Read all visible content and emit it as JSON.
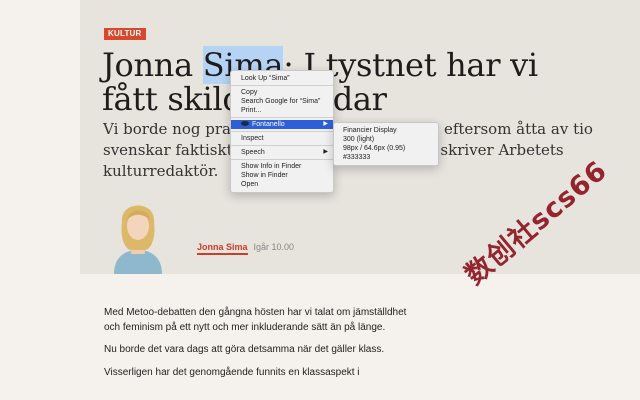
{
  "article": {
    "kicker": "KULTUR",
    "title_before": "Jonna ",
    "title_selected": "Sima",
    "title_after": ": I tystnet har vi fått skilda världar",
    "lede": "Vi borde nog prata mer om klass. Inte minst eftersom åtta av tio svenskar faktiskt anser att klass spelar roll, skriver Arbetets kulturredaktör.",
    "author": "Jonna Sima",
    "time": "Igår 10.00",
    "paragraphs": [
      "Med Metoo-debatten den gångna hösten har vi talat om jämställdhet och feminism på ett nytt och mer inkluderande sätt än på länge.",
      "Nu borde det vara dags att göra detsamma när det gäller klass.",
      "Visserligen har det genomgående funnits en klassaspekt i"
    ]
  },
  "context_menu": {
    "items": [
      "Look Up “Sima”",
      "Copy",
      "Search Google for “Sima”",
      "Print...",
      "Fontanello",
      "Inspect",
      "Speech",
      "Show Info in Finder",
      "Show in Finder",
      "Open"
    ]
  },
  "fontanello": {
    "family": "Financier Display",
    "weight": "300 (light)",
    "size": "98px / 64.6px (0.95)",
    "color": "#333333"
  },
  "watermark": "数创社scs66",
  "colors": {
    "accent": "#d8482c",
    "selection": "#b5d3f5",
    "menu_highlight": "#2d5fd6"
  }
}
